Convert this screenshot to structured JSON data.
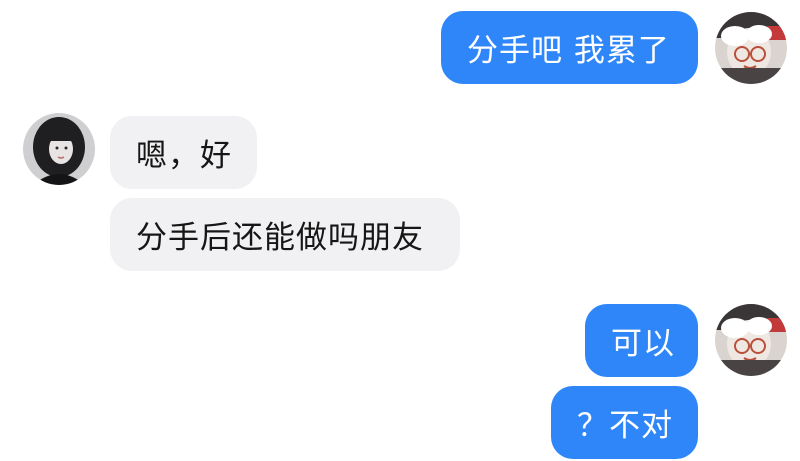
{
  "chat": {
    "messages": [
      {
        "side": "sent",
        "text": "分手吧 我累了"
      },
      {
        "side": "received",
        "text": "嗯，好"
      },
      {
        "side": "received",
        "text": "分手后还能做吗朋友"
      },
      {
        "side": "sent",
        "text": "可以"
      },
      {
        "side": "sent",
        "text": "？不对"
      }
    ]
  },
  "colors": {
    "sent_bubble": "#2f86f8",
    "received_bubble": "#f1f1f3",
    "sent_text": "#ffffff",
    "received_text": "#161616"
  },
  "icons": {
    "self_avatar": "self-avatar-icon",
    "partner_avatar": "partner-avatar-icon"
  }
}
